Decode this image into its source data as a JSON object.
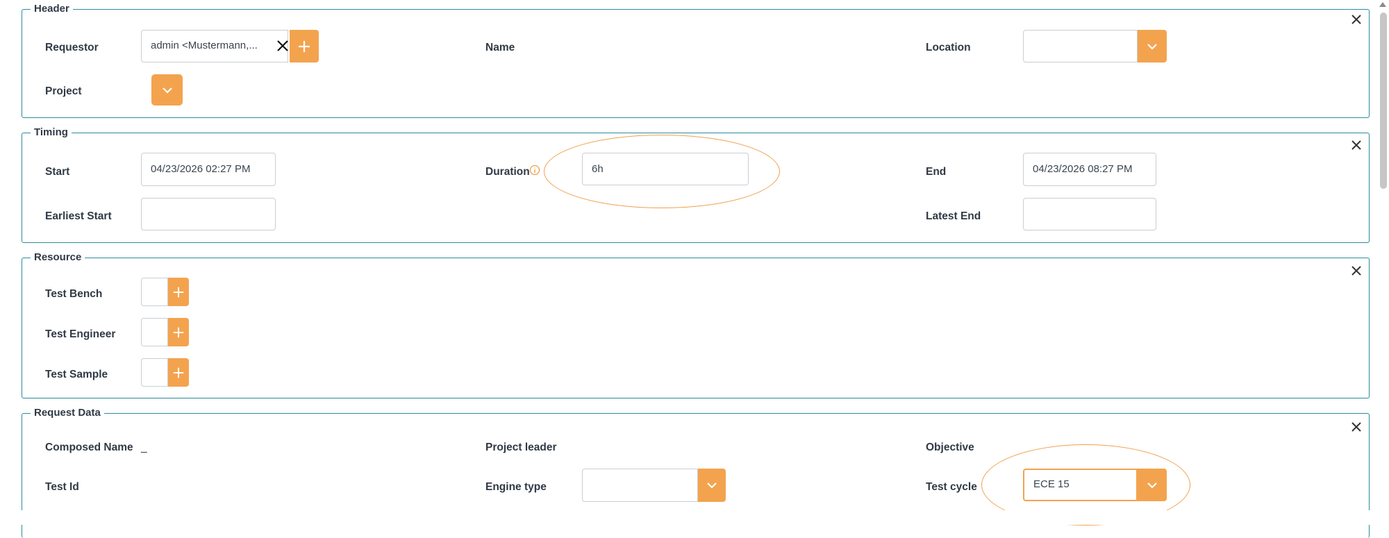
{
  "header": {
    "legend": "Header",
    "requestor_label": "Requestor",
    "requestor_value": "admin <Mustermann,...",
    "name_label": "Name",
    "location_label": "Location",
    "location_value": "",
    "project_label": "Project"
  },
  "timing": {
    "legend": "Timing",
    "start_label": "Start",
    "start_value": "04/23/2026 02:27 PM",
    "duration_label": "Duration",
    "duration_value": "6h",
    "end_label": "End",
    "end_value": "04/23/2026 08:27 PM",
    "earliest_start_label": "Earliest Start",
    "earliest_start_value": "",
    "latest_end_label": "Latest End",
    "latest_end_value": ""
  },
  "resource": {
    "legend": "Resource",
    "test_bench_label": "Test Bench",
    "test_engineer_label": "Test Engineer",
    "test_sample_label": "Test Sample"
  },
  "request_data": {
    "legend": "Request Data",
    "composed_name_label": "Composed Name",
    "composed_name_value": "_",
    "project_leader_label": "Project leader",
    "objective_label": "Objective",
    "test_id_label": "Test Id",
    "engine_type_label": "Engine type",
    "engine_type_value": "",
    "test_cycle_label": "Test cycle",
    "test_cycle_value": "ECE 15"
  },
  "colors": {
    "accent": "#f3a34e",
    "border": "#2a8c9c",
    "annotation": "#f0a04b"
  }
}
